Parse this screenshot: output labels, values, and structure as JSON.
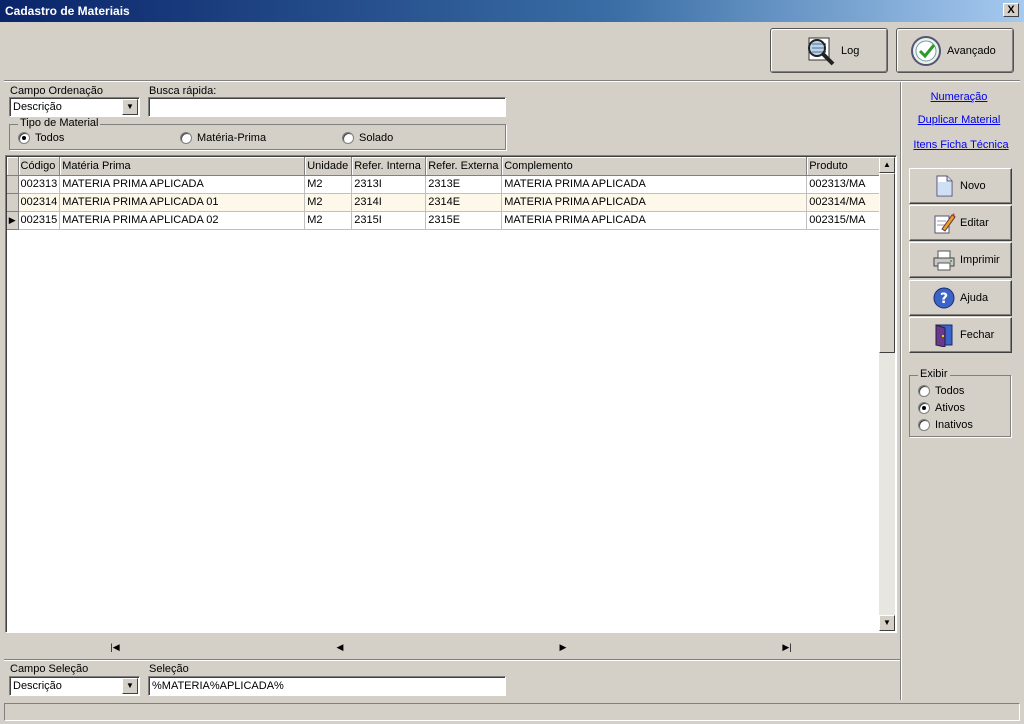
{
  "window": {
    "title": "Cadastro de Materiais",
    "close_glyph": "X"
  },
  "toolbar": {
    "log_label": "Log",
    "advanced_label": "Avançado"
  },
  "filters": {
    "order_field_label": "Campo Ordenação",
    "order_field_value": "Descrição",
    "quick_search_label": "Busca rápida:",
    "quick_search_value": "",
    "material_type": {
      "title": "Tipo de Material",
      "options": [
        "Todos",
        "Matéria-Prima",
        "Solado"
      ],
      "selected": "Todos"
    }
  },
  "grid": {
    "columns": [
      "Código",
      "Matéria Prima",
      "Unidade",
      "Refer. Interna",
      "Refer. Externa",
      "Complemento",
      "Produto"
    ],
    "rows": [
      [
        "002313",
        "MATERIA PRIMA APLICADA",
        "M2",
        "2313I",
        "2313E",
        "MATERIA PRIMA APLICADA",
        "002313/MA"
      ],
      [
        "002314",
        "MATERIA PRIMA APLICADA 01",
        "M2",
        "2314I",
        "2314E",
        "MATERIA PRIMA APLICADA",
        "002314/MA"
      ],
      [
        "002315",
        "MATERIA PRIMA APLICADA 02",
        "M2",
        "2315I",
        "2315E",
        "MATERIA PRIMA APLICADA",
        "002315/MA"
      ]
    ],
    "current_row": 2
  },
  "navigator": {
    "first": "|◀",
    "prior": "◀",
    "next": "▶",
    "last": "▶|"
  },
  "selection": {
    "field_label": "Campo Seleção",
    "field_value": "Descrição",
    "selection_label": "Seleção",
    "selection_value": "%MATERIA%APLICADA%"
  },
  "links": [
    "Numeração",
    "Duplicar Material",
    "Itens Ficha Técnica"
  ],
  "actions": {
    "new": "Novo",
    "edit": "Editar",
    "print": "Imprimir",
    "help": "Ajuda",
    "close": "Fechar"
  },
  "show": {
    "title": "Exibir",
    "options": [
      "Todos",
      "Ativos",
      "Inativos"
    ],
    "selected": "Ativos"
  },
  "colors": {
    "title_start": "#0a246a",
    "title_end": "#a6caf0",
    "link": "#0000ee",
    "face": "#d4d0c8"
  }
}
